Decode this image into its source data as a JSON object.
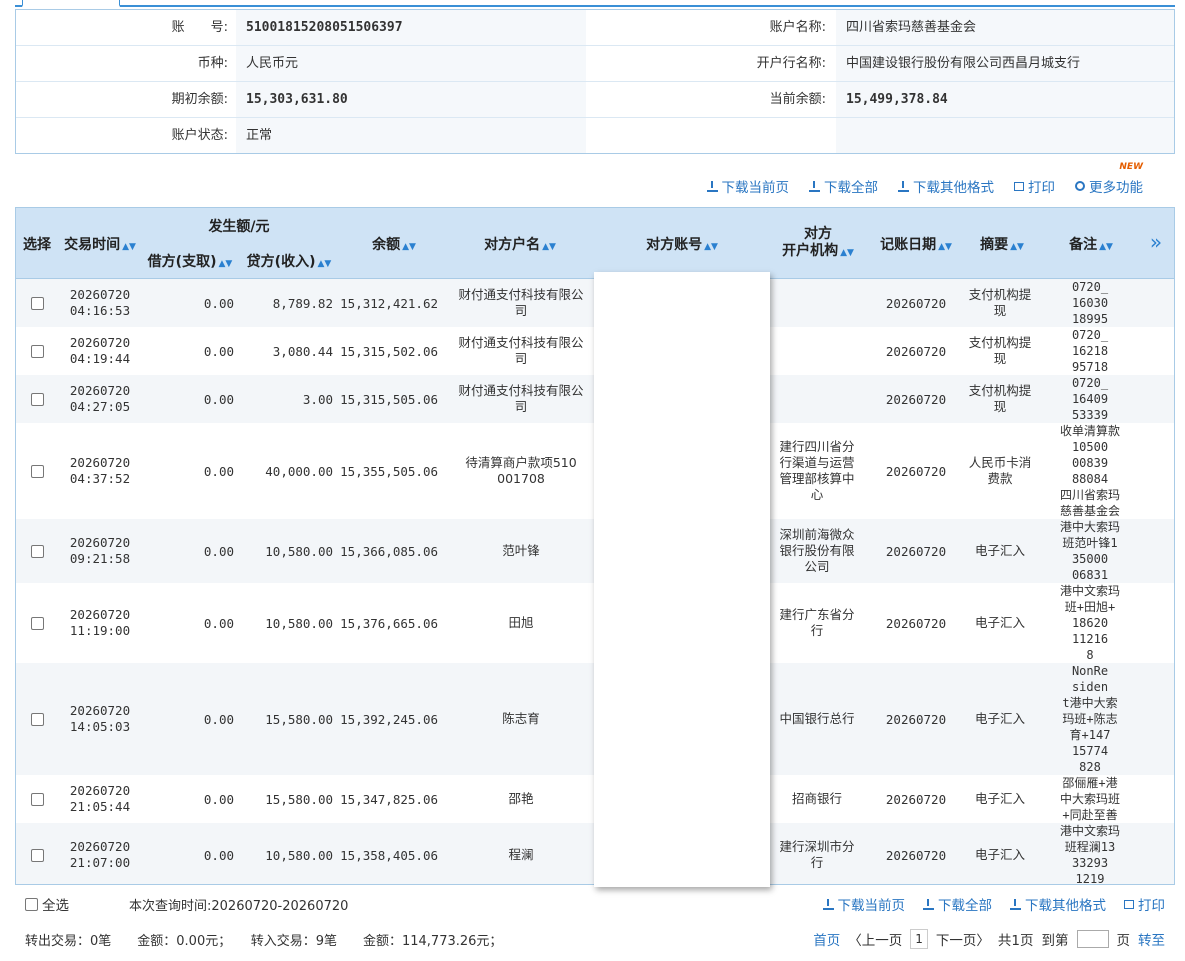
{
  "account": {
    "rows": [
      {
        "l1": "账　　号:",
        "v1": "51001815208051506397",
        "l2": "账户名称:",
        "v2": "四川省索玛慈善基金会"
      },
      {
        "l1": "币种:",
        "v1": "人民币元",
        "l2": "开户行名称:",
        "v2": "中国建设银行股份有限公司西昌月城支行"
      },
      {
        "l1": "期初余额:",
        "v1": "15,303,631.80",
        "l2": "当前余额:",
        "v2": "15,499,378.84"
      },
      {
        "l1": "账户状态:",
        "v1": "正常",
        "l2": "",
        "v2": ""
      }
    ]
  },
  "toolbar": {
    "new_badge": "NEW",
    "download_current": "下载当前页",
    "download_all": "下载全部",
    "download_other": "下载其他格式",
    "print": "打印",
    "more": "更多功能"
  },
  "table": {
    "headers": {
      "select": "选择",
      "time": "交易时间",
      "amount_group": "发生额/元",
      "debit": "借方(支取)",
      "credit": "贷方(收入)",
      "balance": "余额",
      "cp_name": "对方户名",
      "cp_account": "对方账号",
      "cp_org_1": "对方",
      "cp_org_2": "开户机构",
      "date": "记账日期",
      "summary": "摘要",
      "remark": "备注",
      "more": "»"
    },
    "rows": [
      {
        "date1": "20260720",
        "time": "04:16:53",
        "debit": "0.00",
        "credit": "8,789.82",
        "balance": "15,312,421.62",
        "name": [
          "财付通支付科技有限公",
          "司"
        ],
        "org": [],
        "bdate": "20260720",
        "summary": [
          "支付机构提",
          "现"
        ],
        "remark": [
          "0720_",
          "16030",
          "18995"
        ]
      },
      {
        "date1": "20260720",
        "time": "04:19:44",
        "debit": "0.00",
        "credit": "3,080.44",
        "balance": "15,315,502.06",
        "name": [
          "财付通支付科技有限公",
          "司"
        ],
        "org": [],
        "bdate": "20260720",
        "summary": [
          "支付机构提",
          "现"
        ],
        "remark": [
          "0720_",
          "16218",
          "95718"
        ]
      },
      {
        "date1": "20260720",
        "time": "04:27:05",
        "debit": "0.00",
        "credit": "3.00",
        "balance": "15,315,505.06",
        "name": [
          "财付通支付科技有限公",
          "司"
        ],
        "org": [],
        "bdate": "20260720",
        "summary": [
          "支付机构提",
          "现"
        ],
        "remark": [
          "0720_",
          "16409",
          "53339"
        ]
      },
      {
        "date1": "20260720",
        "time": "04:37:52",
        "debit": "0.00",
        "credit": "40,000.00",
        "balance": "15,355,505.06",
        "name": [
          "待清算商户款项510",
          "001708"
        ],
        "org": [
          "建行四川省分",
          "行渠道与运营",
          "管理部核算中",
          "心"
        ],
        "bdate": "20260720",
        "summary": [
          "人民币卡消",
          "费款"
        ],
        "remark": [
          "收单清算款",
          "10500",
          "00839",
          "88084",
          "四川省索玛",
          "慈善基金会"
        ]
      },
      {
        "date1": "20260720",
        "time": "09:21:58",
        "debit": "0.00",
        "credit": "10,580.00",
        "balance": "15,366,085.06",
        "name": [
          "范叶锋"
        ],
        "org": [
          "深圳前海微众",
          "银行股份有限",
          "公司"
        ],
        "bdate": "20260720",
        "summary": [
          "电子汇入"
        ],
        "remark": [
          "港中大索玛",
          "班范叶锋1",
          "35000",
          "06831"
        ]
      },
      {
        "date1": "20260720",
        "time": "11:19:00",
        "debit": "0.00",
        "credit": "10,580.00",
        "balance": "15,376,665.06",
        "name": [
          "田旭"
        ],
        "org": [
          "建行广东省分",
          "行"
        ],
        "bdate": "20260720",
        "summary": [
          "电子汇入"
        ],
        "remark": [
          "港中文索玛",
          "班+田旭+",
          "18620",
          "11216",
          "8"
        ]
      },
      {
        "date1": "20260720",
        "time": "14:05:03",
        "debit": "0.00",
        "credit": "15,580.00",
        "balance": "15,392,245.06",
        "name": [
          "陈志育"
        ],
        "org": [
          "中国银行总行"
        ],
        "bdate": "20260720",
        "summary": [
          "电子汇入"
        ],
        "remark": [
          "NonRe",
          "siden",
          "t港中大索",
          "玛班+陈志",
          "育+147",
          "15774",
          "828"
        ]
      },
      {
        "date1": "20260720",
        "time": "21:05:44",
        "debit": "0.00",
        "credit": "15,580.00",
        "balance": "15,347,825.06",
        "name": [
          "邵艳"
        ],
        "org": [
          "招商银行"
        ],
        "bdate": "20260720",
        "summary": [
          "电子汇入"
        ],
        "remark": [
          "邵俪雁+港",
          "中大索玛班",
          "+同赴至善"
        ]
      },
      {
        "date1": "20260720",
        "time": "21:07:00",
        "debit": "0.00",
        "credit": "10,580.00",
        "balance": "15,358,405.06",
        "name": [
          "程澜"
        ],
        "org": [
          "建行深圳市分",
          "行"
        ],
        "bdate": "20260720",
        "summary": [
          "电子汇入"
        ],
        "remark": [
          "港中文索玛",
          "班程澜13",
          "33293",
          "1219"
        ]
      }
    ]
  },
  "footer": {
    "select_all": "全选",
    "query_time": "本次查询时间:20260720-20260720",
    "download_current": "下载当前页",
    "download_all": "下载全部",
    "download_other": "下载其他格式",
    "print": "打印",
    "summary": "转出交易：0笔　　金额：0.00元；　　转入交易：9笔　　金额：114,773.26元；",
    "first": "首页",
    "prev": "〈上一页",
    "page_num": "1",
    "next": "下一页〉",
    "total": "共1页",
    "goto": "到第",
    "page_unit": "页",
    "go": "转至"
  }
}
